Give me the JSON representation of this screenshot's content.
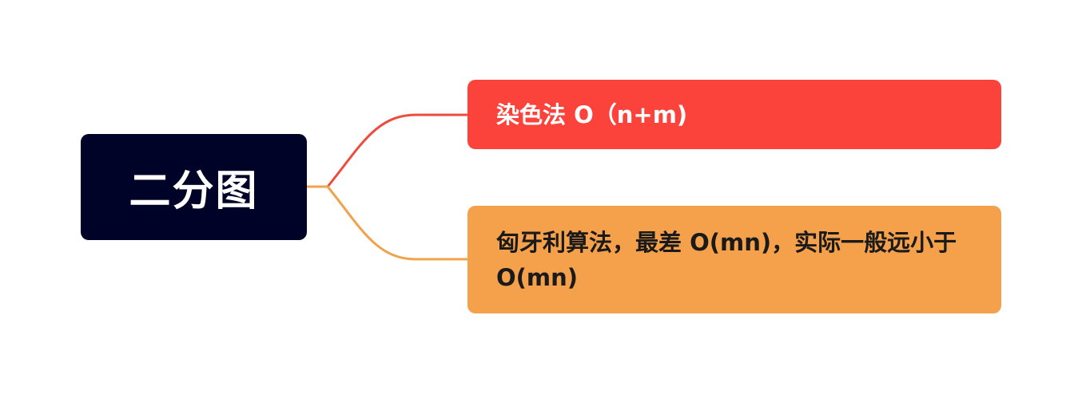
{
  "root": {
    "label": "二分图",
    "color": "#000328"
  },
  "branches": [
    {
      "label": "染色法 O（n+m)",
      "color": "#fc433b",
      "line_color": "#ef4b3b"
    },
    {
      "label": "匈牙利算法，最差 O(mn)，实际一般远小于 O(mn)",
      "color": "#f5a14c",
      "line_color": "#f2a14c"
    }
  ]
}
